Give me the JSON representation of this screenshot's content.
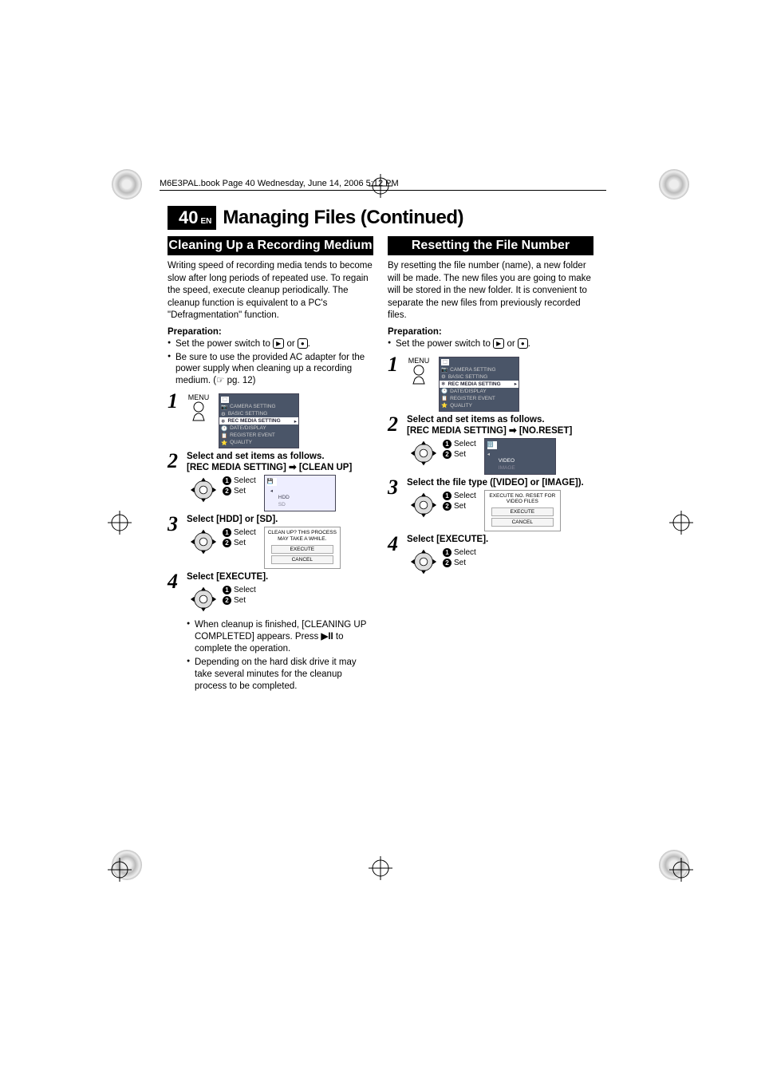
{
  "header_bar": "M6E3PAL.book  Page 40  Wednesday, June 14, 2006  5:12 PM",
  "page_number": "40",
  "page_lang": "EN",
  "main_title": "Managing Files (Continued)",
  "mode_play": "▶",
  "mode_rec": "●",
  "page_ref": "pg. 12",
  "menu_label": "MENU",
  "select_label": "Select",
  "set_label": "Set",
  "arrow_symbol": "➡",
  "playpause_symbol": "▶II",
  "menu_items": {
    "top": "⬚",
    "camera": "CAMERA SETTING",
    "basic": "BASIC SETTING",
    "rec_media": "REC MEDIA SETTING",
    "date": "DATE/DISPLAY",
    "register": "REGISTER EVENT",
    "quality": "QUALITY"
  },
  "left": {
    "section_title": "Cleaning Up a Recording Medium",
    "intro": "Writing speed of recording media tends to become slow after long periods of repeated use. To regain the speed, execute cleanup periodically. The cleanup function is equivalent to a PC's \"Defragmentation\" function.",
    "prep_label": "Preparation:",
    "prep1_a": "Set the power switch to ",
    "prep1_b": " or ",
    "prep1_c": ".",
    "prep2": "Be sure to use the provided AC adapter for the power supply when cleaning up a recording medium. (",
    "prep2_b": ")",
    "step2_title_a": "Select and set items as follows.",
    "step2_title_b": "[REC MEDIA SETTING] ",
    "step2_title_c": " [CLEAN UP]",
    "screen2_item1": "HDD",
    "screen2_item2": "SD",
    "step3_title": "Select [HDD] or [SD].",
    "dialog_msg": "CLEAN UP? THIS PROCESS MAY TAKE A WHILE.",
    "dialog_btn1": "EXECUTE",
    "dialog_btn2": "CANCEL",
    "step4_title": "Select [EXECUTE].",
    "note1_a": "When cleanup is finished, [CLEANING UP COMPLETED] appears. Press ",
    "note1_b": " to complete the operation.",
    "note2": "Depending on the hard disk drive it may take several minutes for the cleanup process to be completed."
  },
  "right": {
    "section_title": "Resetting the File Number",
    "intro": "By resetting the file number (name), a new folder will be made. The new files you are going to make will be stored in the new folder. It is convenient to separate the new files from previously recorded files.",
    "prep_label": "Preparation:",
    "prep1_a": "Set the power switch to ",
    "prep1_b": " or ",
    "prep1_c": ".",
    "step2_title_a": "Select and set items as follows.",
    "step2_title_b": "[REC MEDIA SETTING] ",
    "step2_title_c": " [NO.RESET]",
    "screen2_item1": "VIDEO",
    "screen2_item2": "IMAGE",
    "step3_title": "Select the file type ([VIDEO] or [IMAGE]).",
    "dialog_msg": "EXECUTE NO. RESET FOR VIDEO FILES",
    "dialog_btn1": "EXECUTE",
    "dialog_btn2": "CANCEL",
    "step4_title": "Select [EXECUTE]."
  }
}
